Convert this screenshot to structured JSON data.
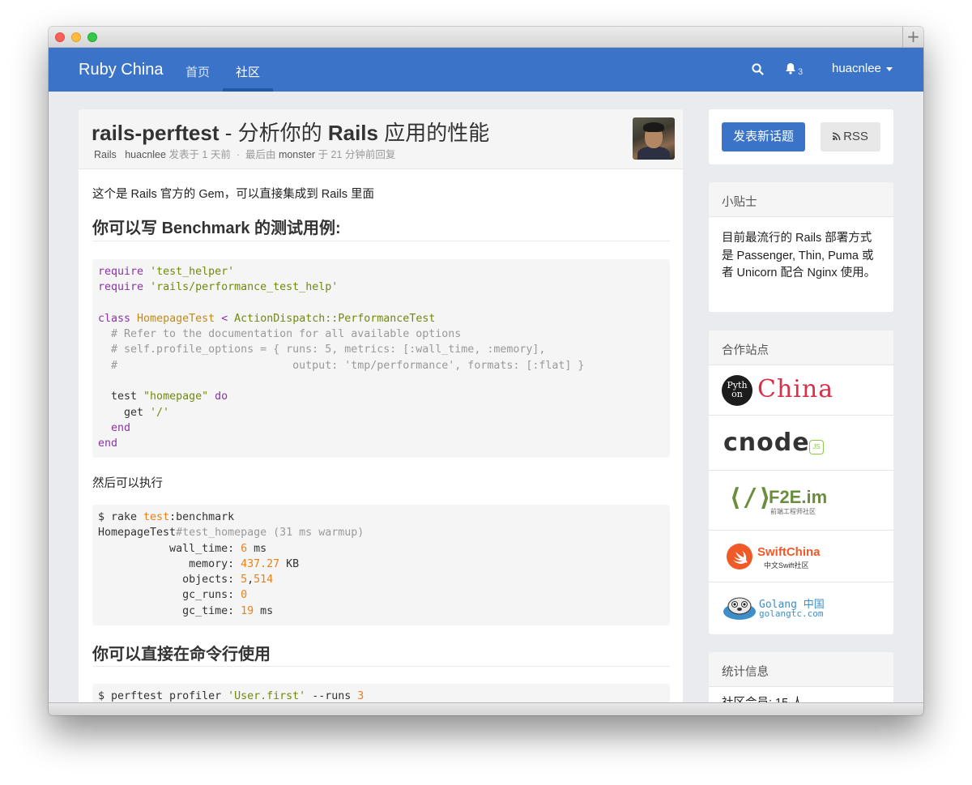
{
  "nav": {
    "brand": "Ruby China",
    "links": [
      "首页",
      "社区"
    ],
    "notification_count": "3",
    "username": "huacnlee"
  },
  "topic": {
    "title_en": "rails-perftest",
    "title_rest": " - 分析你的 ",
    "title_rails": "Rails",
    "title_end": " 应用的性能",
    "node": "Rails",
    "author": "huacnlee",
    "posted": "发表于 1 天前",
    "dot": "·",
    "last_by_label": "最后由",
    "last_user": "monster",
    "last_time": "于 21 分钟前回复"
  },
  "body": {
    "intro": "这个是 Rails 官方的 Gem，可以直接集成到 Rails 里面",
    "heading1_a": "你可以写 ",
    "heading1_b": "Benchmark",
    "heading1_c": " 的测试用例:",
    "after_code": "然后可以执行",
    "heading2": "你可以直接在命令行使用",
    "code1": {
      "l1_kw": "require",
      "l1_str": "'test_helper'",
      "l2_kw": "require",
      "l2_str": "'rails/performance_test_help'",
      "l4_kw": "class",
      "l4_cls": "HomepageTest",
      "l4_op": "<",
      "l4_parent": "ActionDispatch::PerformanceTest",
      "l5": "  # Refer to the documentation for all available options",
      "l6": "  # self.profile_options = { runs: 5, metrics: [:wall_time, :memory],",
      "l7": "  #                           output: 'tmp/performance', formats: [:flat] }",
      "l9_a": "  test ",
      "l9_str": "\"homepage\"",
      "l9_kw": "do",
      "l10_a": "    get ",
      "l10_str": "'/'",
      "l11": "  end",
      "l12": "end"
    },
    "code2": {
      "l1_a": "$ rake ",
      "l1_b": "test",
      "l1_c": ":benchmark",
      "l2_a": "HomepageTest",
      "l2_b": "#test_homepage (31 ms warmup)",
      "l3_a": "           wall_time: ",
      "l3_n": "6",
      "l3_u": " ms",
      "l4_a": "              memory: ",
      "l4_n": "437.27",
      "l4_u": " KB",
      "l5_a": "             objects: ",
      "l5_n": "5",
      "l5_c": ",",
      "l5_n2": "514",
      "l6_a": "             gc_runs: ",
      "l6_n": "0",
      "l7_a": "             gc_time: ",
      "l7_n": "19",
      "l7_u": " ms"
    },
    "code3": {
      "l1_a": "$ perftest profiler ",
      "l1_str": "'User.first'",
      "l1_b": " --runs ",
      "l1_n": "3"
    }
  },
  "sidebar": {
    "new_topic": "发表新话题",
    "rss": "RSS",
    "tips_title": "小贴士",
    "tips_text": "目前最流行的 Rails 部署方式是 Passenger, Thin, Puma 或者 Unicorn 配合 Nginx 使用。",
    "partners_title": "合作站点",
    "partners": {
      "python_a": "Pyth",
      "python_b": "on",
      "python_china": "China",
      "cnode": "cnode",
      "cnode_js": "JS",
      "f2e": "F2E.im",
      "f2e_sub": "前端工程师社区",
      "swift": "SwiftChina",
      "swift_sub": "中文Swift社区",
      "golang_a": "Golang 中国",
      "golang_b": "golangtc.com"
    },
    "stats_title": "统计信息",
    "stats_line": "社区会员: 15 人"
  },
  "colors": {
    "nav": "#3b73c8",
    "primary": "#3b73c8"
  }
}
